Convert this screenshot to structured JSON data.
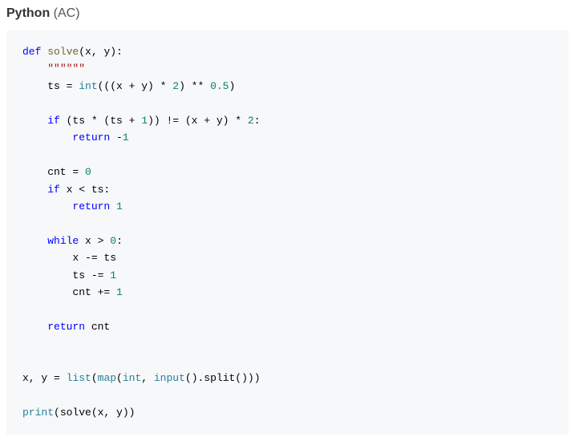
{
  "header": {
    "language": "Python",
    "status": "(AC)"
  },
  "code": {
    "tokens": [
      {
        "c": "k",
        "t": "def"
      },
      {
        "c": "op",
        "t": " "
      },
      {
        "c": "fn",
        "t": "solve"
      },
      {
        "c": "op",
        "t": "(x, y):"
      },
      {
        "nl": true
      },
      {
        "c": "op",
        "t": "    "
      },
      {
        "c": "str",
        "t": "\"\"\"\"\"\""
      },
      {
        "nl": true
      },
      {
        "c": "op",
        "t": "    ts = "
      },
      {
        "c": "bi",
        "t": "int"
      },
      {
        "c": "op",
        "t": "(((x + y) * "
      },
      {
        "c": "num",
        "t": "2"
      },
      {
        "c": "op",
        "t": ") ** "
      },
      {
        "c": "num",
        "t": "0.5"
      },
      {
        "c": "op",
        "t": ")"
      },
      {
        "nl": true
      },
      {
        "nl": true
      },
      {
        "c": "op",
        "t": "    "
      },
      {
        "c": "k",
        "t": "if"
      },
      {
        "c": "op",
        "t": " (ts * (ts + "
      },
      {
        "c": "num",
        "t": "1"
      },
      {
        "c": "op",
        "t": ")) != (x + y) * "
      },
      {
        "c": "num",
        "t": "2"
      },
      {
        "c": "op",
        "t": ":"
      },
      {
        "nl": true
      },
      {
        "c": "op",
        "t": "        "
      },
      {
        "c": "k",
        "t": "return"
      },
      {
        "c": "op",
        "t": " -"
      },
      {
        "c": "num",
        "t": "1"
      },
      {
        "nl": true
      },
      {
        "nl": true
      },
      {
        "c": "op",
        "t": "    cnt = "
      },
      {
        "c": "num",
        "t": "0"
      },
      {
        "nl": true
      },
      {
        "c": "op",
        "t": "    "
      },
      {
        "c": "k",
        "t": "if"
      },
      {
        "c": "op",
        "t": " x < ts:"
      },
      {
        "nl": true
      },
      {
        "c": "op",
        "t": "        "
      },
      {
        "c": "k",
        "t": "return"
      },
      {
        "c": "op",
        "t": " "
      },
      {
        "c": "num",
        "t": "1"
      },
      {
        "nl": true
      },
      {
        "nl": true
      },
      {
        "c": "op",
        "t": "    "
      },
      {
        "c": "k",
        "t": "while"
      },
      {
        "c": "op",
        "t": " x > "
      },
      {
        "c": "num",
        "t": "0"
      },
      {
        "c": "op",
        "t": ":"
      },
      {
        "nl": true
      },
      {
        "c": "op",
        "t": "        x -= ts"
      },
      {
        "nl": true
      },
      {
        "c": "op",
        "t": "        ts -= "
      },
      {
        "c": "num",
        "t": "1"
      },
      {
        "nl": true
      },
      {
        "c": "op",
        "t": "        cnt += "
      },
      {
        "c": "num",
        "t": "1"
      },
      {
        "nl": true
      },
      {
        "nl": true
      },
      {
        "c": "op",
        "t": "    "
      },
      {
        "c": "k",
        "t": "return"
      },
      {
        "c": "op",
        "t": " cnt"
      },
      {
        "nl": true
      },
      {
        "nl": true
      },
      {
        "nl": true
      },
      {
        "c": "op",
        "t": "x, y = "
      },
      {
        "c": "bi",
        "t": "list"
      },
      {
        "c": "op",
        "t": "("
      },
      {
        "c": "bi",
        "t": "map"
      },
      {
        "c": "op",
        "t": "("
      },
      {
        "c": "bi",
        "t": "int"
      },
      {
        "c": "op",
        "t": ", "
      },
      {
        "c": "bi",
        "t": "input"
      },
      {
        "c": "op",
        "t": "().split()))"
      },
      {
        "nl": true
      },
      {
        "nl": true
      },
      {
        "c": "bi",
        "t": "print"
      },
      {
        "c": "op",
        "t": "(solve(x, y))"
      }
    ]
  }
}
